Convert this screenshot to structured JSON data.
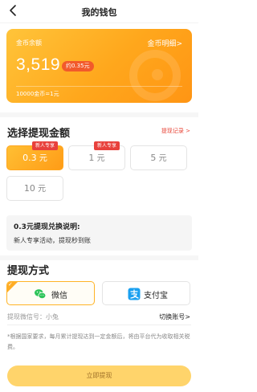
{
  "header": {
    "title": "我的钱包"
  },
  "balance_card": {
    "label": "金币余额",
    "detail_link": "金币明细>",
    "value": "3,519",
    "approx": "约0.35元",
    "rate": "10000金币=1元"
  },
  "withdraw_amount": {
    "title": "选择提现金额",
    "records_link": "提现记录 >",
    "options": [
      {
        "label": "0.3",
        "unit": "元",
        "badge": "新人专享",
        "selected": true
      },
      {
        "label": "1",
        "unit": "元",
        "badge": "新人专享",
        "selected": false
      },
      {
        "label": "5",
        "unit": "元",
        "badge": "",
        "selected": false
      },
      {
        "label": "10",
        "unit": "元",
        "badge": "",
        "selected": false
      }
    ]
  },
  "info": {
    "title": "0.3元提现兑换说明:",
    "desc": "新人专享活动，提现秒到账"
  },
  "method": {
    "title": "提现方式",
    "options": [
      {
        "label": "微信",
        "icon": "wechat-icon",
        "selected": true,
        "color": "#2ec45a"
      },
      {
        "label": "支付宝",
        "icon": "alipay-icon",
        "selected": false,
        "color": "#1aa0f0"
      }
    ]
  },
  "account": {
    "label": "提现微信号：小兔",
    "switch": "切换账号>"
  },
  "notice": "*根据国家要求，每月累计提现达到一定金额后，将由平台代为收取相关税费。",
  "submit": {
    "label": "立即提现"
  },
  "colors": {
    "accent": "#ffa71c",
    "badge": "#e8413c",
    "link_red": "#e8483b",
    "submit_bg": "#ffd46b"
  }
}
